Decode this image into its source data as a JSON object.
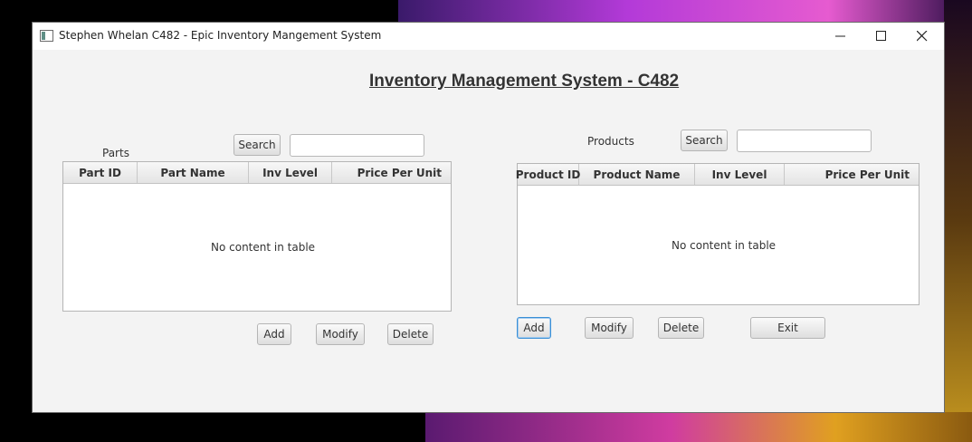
{
  "window": {
    "title": "Stephen Whelan C482 - Epic Inventory Mangement System"
  },
  "main": {
    "title": "Inventory Management System - C482"
  },
  "parts": {
    "label": "Parts",
    "search_button": "Search",
    "search_value": "",
    "columns": [
      "Part ID",
      "Part Name",
      "Inv Level",
      "Price Per Unit"
    ],
    "empty_text": "No content in table",
    "add_label": "Add",
    "modify_label": "Modify",
    "delete_label": "Delete"
  },
  "products": {
    "label": "Products",
    "search_button": "Search",
    "search_value": "",
    "columns": [
      "Product ID",
      "Product Name",
      "Inv Level",
      "Price Per Unit"
    ],
    "empty_text": "No content in table",
    "add_label": "Add",
    "modify_label": "Modify",
    "delete_label": "Delete",
    "exit_label": "Exit"
  },
  "icons": {
    "app": "app-window-icon",
    "minimize": "minimize-icon",
    "maximize": "maximize-icon",
    "close": "close-icon"
  },
  "colors": {
    "window_bg": "#f3f3f3",
    "focus_border": "#3a8fd6"
  }
}
